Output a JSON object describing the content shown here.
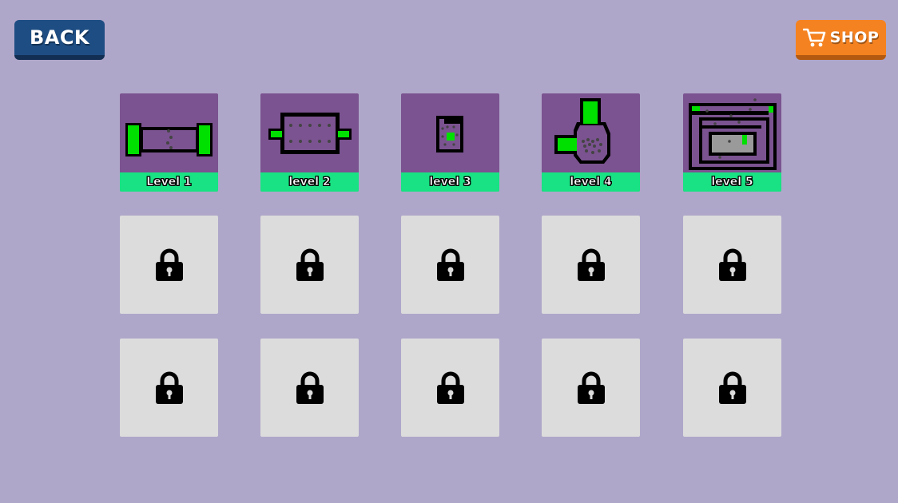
{
  "header": {
    "back_label": "BACK",
    "shop_label": "SHOP",
    "shop_icon": "cart-icon"
  },
  "colors": {
    "background": "#afa7c9",
    "back_button": "#1e4d83",
    "shop_button": "#f58220",
    "unlocked_tile": "#7b5390",
    "locked_tile": "#dcdcdc",
    "label_bar": "#18e283",
    "level_floor": "#00e000"
  },
  "levels": [
    {
      "label": "Level 1",
      "locked": false
    },
    {
      "label": "level 2",
      "locked": false
    },
    {
      "label": "level 3",
      "locked": false
    },
    {
      "label": "level 4",
      "locked": false
    },
    {
      "label": "level 5",
      "locked": false
    },
    {
      "label": "",
      "locked": true,
      "icon": "lock-icon"
    },
    {
      "label": "",
      "locked": true,
      "icon": "lock-icon"
    },
    {
      "label": "",
      "locked": true,
      "icon": "lock-icon"
    },
    {
      "label": "",
      "locked": true,
      "icon": "lock-icon"
    },
    {
      "label": "",
      "locked": true,
      "icon": "lock-icon"
    },
    {
      "label": "",
      "locked": true,
      "icon": "lock-icon"
    },
    {
      "label": "",
      "locked": true,
      "icon": "lock-icon"
    },
    {
      "label": "",
      "locked": true,
      "icon": "lock-icon"
    },
    {
      "label": "",
      "locked": true,
      "icon": "lock-icon"
    },
    {
      "label": "",
      "locked": true,
      "icon": "lock-icon"
    }
  ]
}
